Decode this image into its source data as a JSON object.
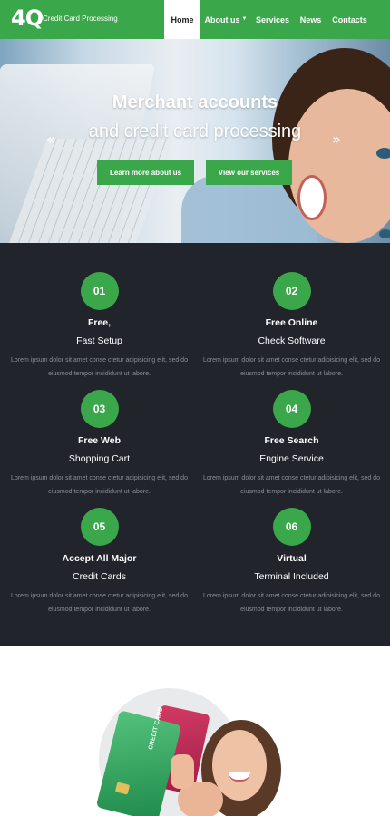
{
  "header": {
    "logo": "4Q",
    "tagline": "Credit Card Processing",
    "nav": [
      {
        "label": "Home",
        "active": true
      },
      {
        "label": "About us",
        "has_dropdown": true
      },
      {
        "label": "Services"
      },
      {
        "label": "News"
      },
      {
        "label": "Contacts"
      }
    ],
    "dropdown_icon": "chevron-down-icon"
  },
  "hero": {
    "title": "Merchant accounts",
    "subtitle": "and credit card processing",
    "prev_icon": "«",
    "next_icon": "»",
    "button1": "Learn more about us",
    "button2": "View our services"
  },
  "features": [
    {
      "number": "01",
      "title1": "Free,",
      "title2": "Fast Setup",
      "desc": "Lorem ipsum dolor sit amet conse ctetur adipisicing elit, sed do eiusmod tempor incididunt ut labore."
    },
    {
      "number": "02",
      "title1": "Free Online",
      "title2": "Check Software",
      "desc": "Lorem ipsum dolor sit amet conse ctetur adipisicing elit, sed do eiusmod tempor incididunt ut labore."
    },
    {
      "number": "03",
      "title1": "Free Web",
      "title2": "Shopping Cart",
      "desc": "Lorem ipsum dolor sit amet conse ctetur adipisicing elit, sed do eiusmod tempor incididunt ut labore."
    },
    {
      "number": "04",
      "title1": "Free Search",
      "title2": "Engine Service",
      "desc": "Lorem ipsum dolor sit amet conse ctetur adipisicing elit, sed do eiusmod tempor incididunt ut labore."
    },
    {
      "number": "05",
      "title1": "Accept All Major",
      "title2": "Credit Cards",
      "desc": "Lorem ipsum dolor sit amet conse ctetur adipisicing elit, sed do eiusmod tempor incididunt ut labore."
    },
    {
      "number": "06",
      "title1": "Virtual",
      "title2": "Terminal Included",
      "desc": "Lorem ipsum dolor sit amet conse ctetur adipisicing elit, sed do eiusmod tempor incididunt ut labore."
    }
  ],
  "bottom": {
    "card_text": "CREDIT CARD"
  },
  "colors": {
    "accent": "#3aa84a",
    "dark_bg": "#21242b",
    "muted_text": "#8a8e96"
  }
}
